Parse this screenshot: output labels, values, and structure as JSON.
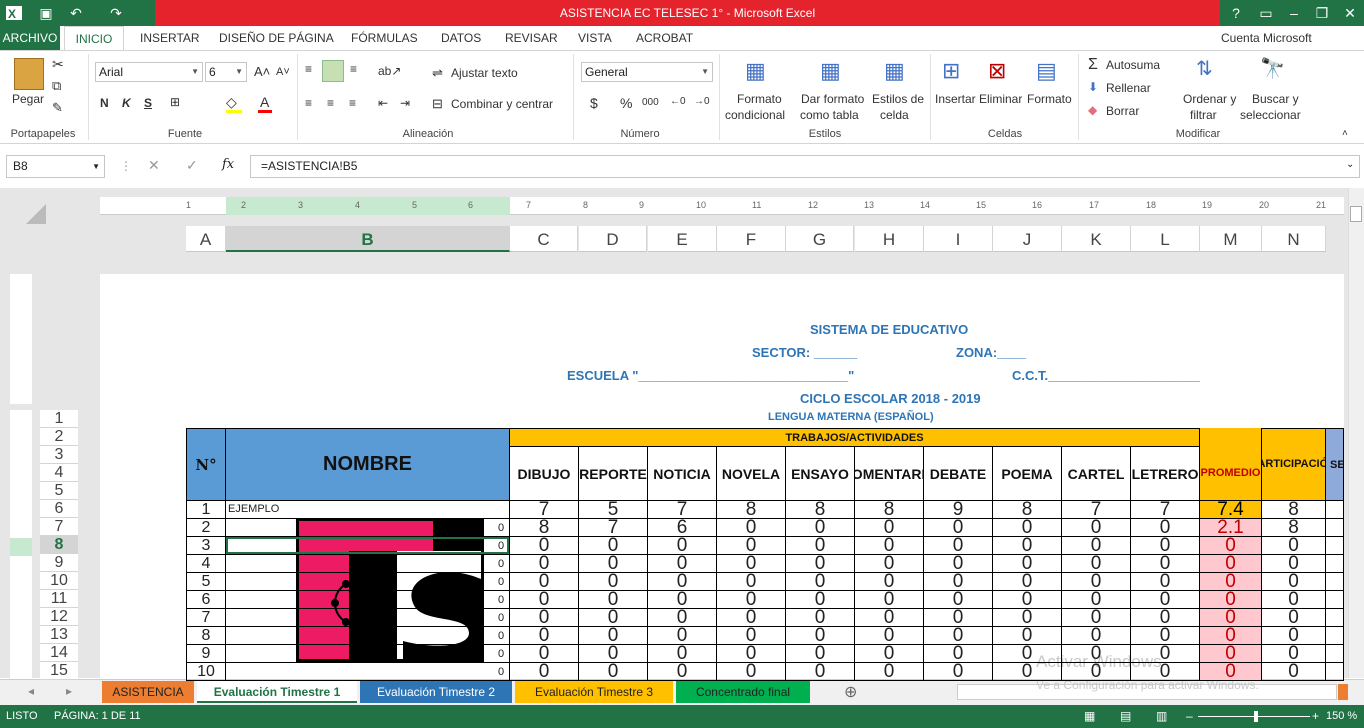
{
  "window": {
    "title": "ASISTENCIA EC  TELESEC 1° -  Microsoft Excel",
    "account": "Cuenta Microsoft",
    "help": "?"
  },
  "tabs": [
    "ARCHIVO",
    "INICIO",
    "INSERTAR",
    "DISEÑO DE PÁGINA",
    "FÓRMULAS",
    "DATOS",
    "REVISAR",
    "VISTA",
    "ACROBAT"
  ],
  "ribbon": {
    "paste": "Pegar",
    "font_name": "Arial",
    "font_size": "6",
    "bold": "N",
    "italic": "K",
    "underline": "S",
    "wrap": "Ajustar texto",
    "merge": "Combinar y centrar",
    "number_format": "General",
    "currency": "$",
    "percent": "%",
    "thousands": "000",
    "cond_format_1": "Formato",
    "cond_format_2": "condicional",
    "table_format_1": "Dar formato",
    "table_format_2": "como tabla",
    "cell_styles_1": "Estilos de",
    "cell_styles_2": "celda",
    "insert": "Insertar",
    "delete": "Eliminar",
    "format": "Formato",
    "autosum": "Autosuma",
    "fill": "Rellenar",
    "clear": "Borrar",
    "sort_1": "Ordenar y",
    "sort_2": "filtrar",
    "find_1": "Buscar y",
    "find_2": "seleccionar",
    "groups": [
      "Portapapeles",
      "Fuente",
      "Alineación",
      "Número",
      "Estilos",
      "Celdas",
      "Modificar"
    ]
  },
  "formula_bar": {
    "namebox": "B8",
    "formula": "=ASISTENCIA!B5",
    "fx": "fx"
  },
  "columns": [
    "A",
    "B",
    "C",
    "D",
    "E",
    "F",
    "G",
    "H",
    "I",
    "J",
    "K",
    "L",
    "M",
    "N"
  ],
  "ruler": [
    "1",
    "2",
    "3",
    "4",
    "5",
    "6",
    "7",
    "8",
    "9",
    "10",
    "11",
    "12",
    "13",
    "14",
    "15",
    "16",
    "17",
    "18",
    "19",
    "20",
    "21"
  ],
  "row_numbers": [
    "1",
    "2",
    "3",
    "4",
    "5",
    "6",
    "7",
    "8",
    "9",
    "10",
    "11",
    "12",
    "13",
    "14",
    "15"
  ],
  "doc": {
    "title": "SISTEMA DE EDUCATIVO",
    "sector": "SECTOR: ______",
    "zona": "ZONA:____",
    "escuela": "ESCUELA \"_____________________________\"",
    "cct": "C.C.T._____________________",
    "ciclo": "CICLO ESCOLAR 2018 - 2019",
    "materia": "LENGUA MATERNA (ESPAÑOL)"
  },
  "table": {
    "col_no": "N°",
    "col_nombre": "NOMBRE",
    "col_trabajos": "TRABAJOS/ACTIVIDADES",
    "col_prom": "PROMEDIO",
    "col_part": "PARTICIPACIÓN",
    "col_extra": "SE",
    "activities": [
      "DIBUJO",
      "REPORTE",
      "NOTICIA",
      "NOVELA",
      "ENSAYO",
      "COMENTARIO",
      "DEBATE",
      "POEMA",
      "CARTEL",
      "LETRERO"
    ],
    "rows": [
      {
        "n": "1",
        "name": "EJEMPLO",
        "side": "",
        "v": [
          "7",
          "5",
          "7",
          "8",
          "8",
          "8",
          "9",
          "8",
          "7",
          "7"
        ],
        "p": "7.4",
        "q": "8"
      },
      {
        "n": "2",
        "name": "",
        "side": "0",
        "v": [
          "8",
          "7",
          "6",
          "0",
          "0",
          "0",
          "0",
          "0",
          "0",
          "0"
        ],
        "p": "2.1",
        "q": "8"
      },
      {
        "n": "3",
        "name": "",
        "side": "0",
        "v": [
          "0",
          "0",
          "0",
          "0",
          "0",
          "0",
          "0",
          "0",
          "0",
          "0"
        ],
        "p": "0",
        "q": "0"
      },
      {
        "n": "4",
        "name": "",
        "side": "0",
        "v": [
          "0",
          "0",
          "0",
          "0",
          "0",
          "0",
          "0",
          "0",
          "0",
          "0"
        ],
        "p": "0",
        "q": "0"
      },
      {
        "n": "5",
        "name": "",
        "side": "0",
        "v": [
          "0",
          "0",
          "0",
          "0",
          "0",
          "0",
          "0",
          "0",
          "0",
          "0"
        ],
        "p": "0",
        "q": "0"
      },
      {
        "n": "6",
        "name": "",
        "side": "0",
        "v": [
          "0",
          "0",
          "0",
          "0",
          "0",
          "0",
          "0",
          "0",
          "0",
          "0"
        ],
        "p": "0",
        "q": "0"
      },
      {
        "n": "7",
        "name": "",
        "side": "0",
        "v": [
          "0",
          "0",
          "0",
          "0",
          "0",
          "0",
          "0",
          "0",
          "0",
          "0"
        ],
        "p": "0",
        "q": "0"
      },
      {
        "n": "8",
        "name": "",
        "side": "0",
        "v": [
          "0",
          "0",
          "0",
          "0",
          "0",
          "0",
          "0",
          "0",
          "0",
          "0"
        ],
        "p": "0",
        "q": "0"
      },
      {
        "n": "9",
        "name": "",
        "side": "0",
        "v": [
          "0",
          "0",
          "0",
          "0",
          "0",
          "0",
          "0",
          "0",
          "0",
          "0"
        ],
        "p": "0",
        "q": "0"
      },
      {
        "n": "10",
        "name": "",
        "side": "0",
        "v": [
          "0",
          "0",
          "0",
          "0",
          "0",
          "0",
          "0",
          "0",
          "0",
          "0"
        ],
        "p": "0",
        "q": "0"
      }
    ]
  },
  "sheet_tabs": [
    {
      "label": "ASISTENCIA",
      "color": "#ed7d31"
    },
    {
      "label": "Evaluación Timestre 1",
      "color": "#ffffff"
    },
    {
      "label": "Evaluación Timestre 2",
      "color": "#2e75b6"
    },
    {
      "label": "Evaluación Timestre 3",
      "color": "#ffc000"
    },
    {
      "label": "Concentrado final",
      "color": "#00b050"
    }
  ],
  "status": {
    "ready": "LISTO",
    "page": "PÁGINA: 1 DE 11",
    "zoom": "150 %"
  },
  "watermark": {
    "line1": "Activar Windows",
    "line2": "Ve a Configuración para activar Windows."
  },
  "colors": {
    "excel_green": "#217346",
    "title_red": "#e5232d",
    "header_blue": "#5b9bd5",
    "header_gold": "#ffc000",
    "avg_pink": "#ffc7ce",
    "avg_red": "#c00000"
  }
}
